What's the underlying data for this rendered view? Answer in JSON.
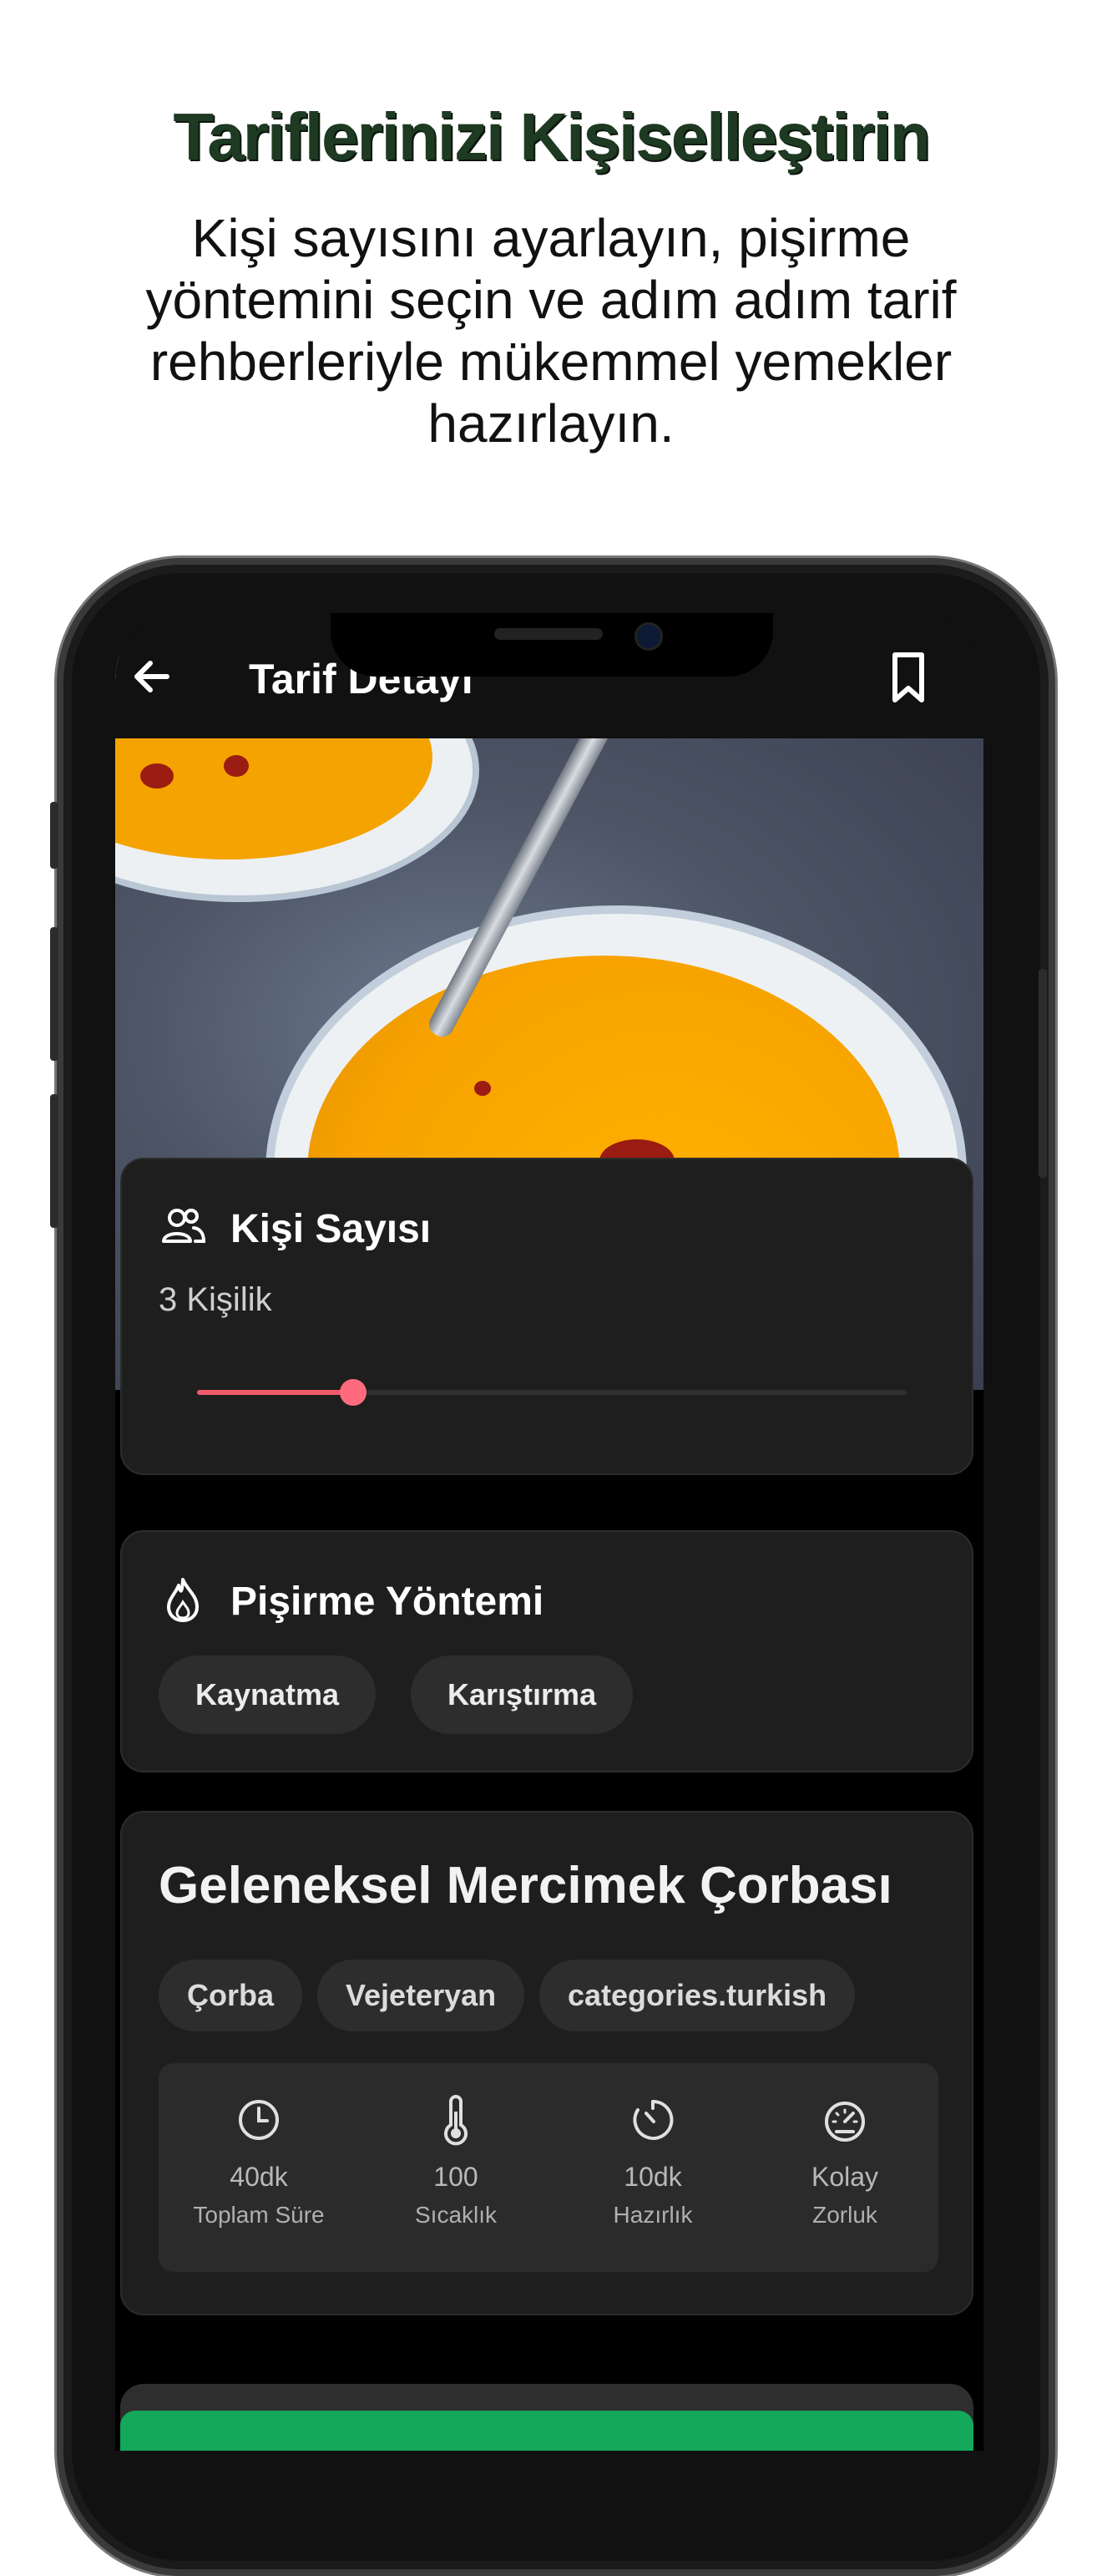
{
  "promo": {
    "headline": "Tariflerinizi Kişiselleştirin",
    "subtitle": "Kişi sayısını ayarlayın, pişirme yöntemini seçin ve adım adım tarif rehberleriyle mükemmel yemekler hazırlayın."
  },
  "appbar": {
    "title": "Tarif Detayı",
    "back_icon": "arrow-left-icon",
    "bookmark_icon": "bookmark-icon"
  },
  "persons": {
    "title": "Kişi Sayısı",
    "icon": "users-icon",
    "value_label": "3 Kişilik",
    "slider_fraction": 0.22,
    "accent": "#ef5a6b"
  },
  "cooking_method": {
    "title": "Pişirme Yöntemi",
    "icon": "flame-icon",
    "options": [
      "Kaynatma",
      "Karıştırma"
    ]
  },
  "recipe": {
    "title": "Geleneksel Mercimek Çorbası",
    "tags": [
      "Çorba",
      "Vejeteryan",
      "categories.turkish"
    ],
    "stats": [
      {
        "icon": "clock-icon",
        "value": "40dk",
        "label": "Toplam Süre"
      },
      {
        "icon": "thermometer-icon",
        "value": "100",
        "label": "Sıcaklık"
      },
      {
        "icon": "timer-icon",
        "value": "10dk",
        "label": "Hazırlık"
      },
      {
        "icon": "gauge-icon",
        "value": "Kolay",
        "label": "Zorluk"
      }
    ]
  },
  "colors": {
    "headline": "#1e3a22",
    "card_bg": "#1e1e1e",
    "chip_bg": "#2d2d2d",
    "primary_green": "#13a85a"
  }
}
